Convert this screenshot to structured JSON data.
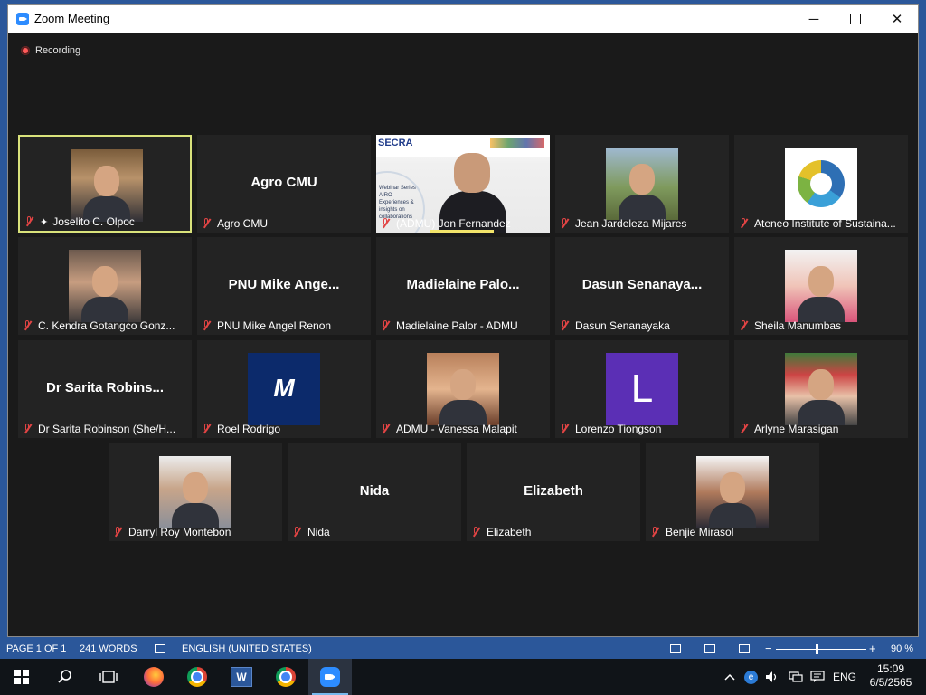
{
  "window": {
    "title": "Zoom Meeting",
    "minimize": "─",
    "close": "✕"
  },
  "recording": {
    "label": "Recording"
  },
  "participants": [
    {
      "name": "Joselito C. Olpoc",
      "photo": "ph-jos",
      "active": true,
      "pinned": true
    },
    {
      "name": "Agro CMU",
      "big": "Agro CMU"
    },
    {
      "name": "(ADMU) Jon Fernandez",
      "slide": true
    },
    {
      "name": "Jean Jardeleza Mijares",
      "photo": "ph-jean"
    },
    {
      "name": "Ateneo Institute of Sustaina...",
      "photo": "ph-ateneo",
      "logo": "ateneo"
    },
    {
      "name": "C. Kendra Gotangco Gonz...",
      "photo": "ph-kendra"
    },
    {
      "name": "PNU Mike Angel Renon",
      "big": "PNU Mike Ange..."
    },
    {
      "name": "Madielaine Palor - ADMU",
      "big": "Madielaine Palo..."
    },
    {
      "name": "Dasun Senanayaka",
      "big": "Dasun Senanaya..."
    },
    {
      "name": "Sheila Manumbas",
      "photo": "ph-sheila"
    },
    {
      "name": "Dr Sarita Robinson (She/H...",
      "big": "Dr Sarita Robins..."
    },
    {
      "name": "Roel Rodrigo",
      "photo": "ph-roel",
      "logo": "roel",
      "logo_text": "M"
    },
    {
      "name": "ADMU - Vanessa Malapit",
      "photo": "ph-vanessa"
    },
    {
      "name": "Lorenzo Tiongson",
      "photo": "ph-lorenzo",
      "letter": "L"
    },
    {
      "name": "Arlyne Marasigan",
      "photo": "ph-arlyne"
    },
    {
      "name": "Darryl Roy Montebon",
      "photo": "ph-darryl"
    },
    {
      "name": "Nida",
      "big": "Nida"
    },
    {
      "name": "Elizabeth",
      "big": "Elizabeth"
    },
    {
      "name": "Benjie Mirasol",
      "photo": "ph-benjie"
    }
  ],
  "slide": {
    "org": "SECRA",
    "text": "Webinar Series AIRO Experiences & insights on collaborations"
  },
  "word_status": {
    "page": "PAGE 1 OF 1",
    "words": "241 WORDS",
    "language": "ENGLISH (UNITED STATES)",
    "zoom": "90 %"
  },
  "taskbar": {
    "items": [
      "start",
      "search",
      "task-view",
      "firefox",
      "chrome",
      "word",
      "chrome",
      "zoom"
    ],
    "active": "zoom",
    "lang": "ENG",
    "time": "15:09",
    "date": "6/5/2565"
  },
  "colors": {
    "accent": "#2b579a",
    "active_border": "#d9e27b",
    "mute": "#e24444"
  }
}
